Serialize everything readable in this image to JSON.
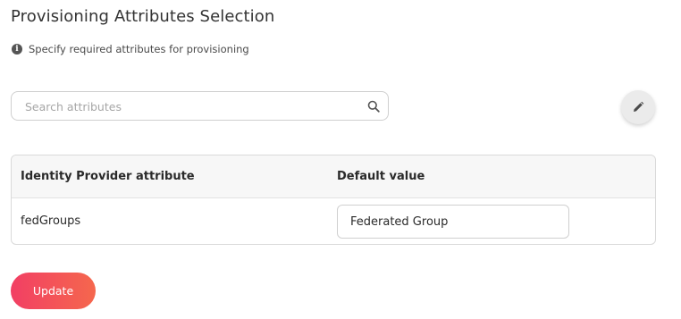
{
  "page": {
    "title": "Provisioning Attributes Selection",
    "hint": "Specify required attributes for provisioning"
  },
  "search": {
    "placeholder": "Search attributes",
    "value": ""
  },
  "table": {
    "headers": [
      "Identity Provider attribute",
      "Default value"
    ],
    "rows": [
      {
        "attribute": "fedGroups",
        "default_value": "Federated Group"
      }
    ]
  },
  "actions": {
    "update_label": "Update"
  },
  "colors": {
    "accent_start": "#f23f64",
    "accent_end": "#f5674d"
  },
  "icons": {
    "hint": "info-icon",
    "search": "search-icon",
    "edit": "pencil-icon"
  }
}
